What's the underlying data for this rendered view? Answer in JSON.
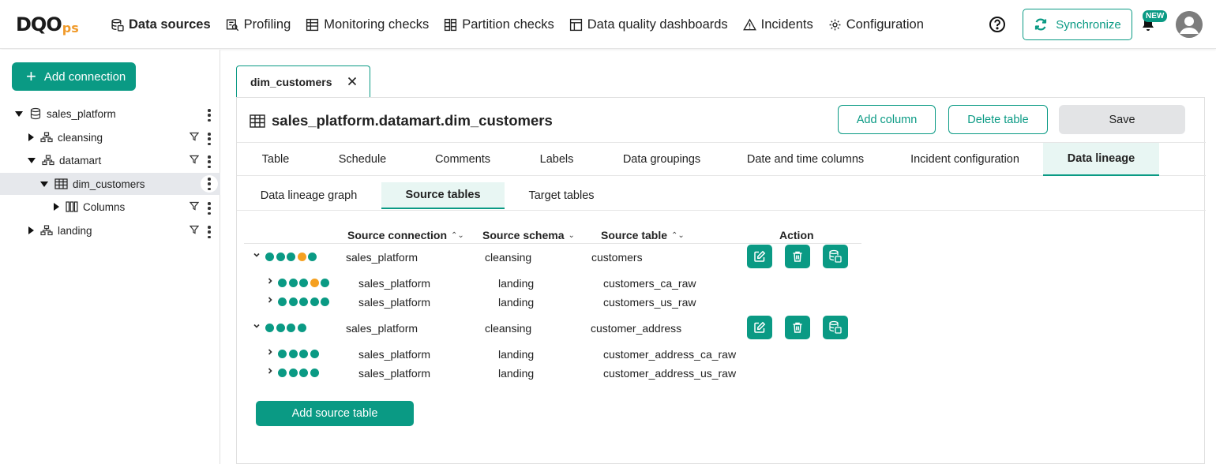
{
  "logo": {
    "main": "DQO",
    "sub": "ps"
  },
  "nav": {
    "items": [
      {
        "label": "Data sources",
        "icon": "database-icon",
        "active": true
      },
      {
        "label": "Profiling",
        "icon": "profiling-icon"
      },
      {
        "label": "Monitoring checks",
        "icon": "monitoring-icon"
      },
      {
        "label": "Partition checks",
        "icon": "partition-icon"
      },
      {
        "label": "Data quality dashboards",
        "icon": "dashboard-icon"
      },
      {
        "label": "Incidents",
        "icon": "warning-icon"
      },
      {
        "label": "Configuration",
        "icon": "gear-icon"
      }
    ],
    "synchronize_label": "Synchronize",
    "new_badge": "NEW"
  },
  "sidebar": {
    "add_connection_label": "Add connection",
    "tree": [
      {
        "label": "sales_platform",
        "level": 0,
        "expanded": true,
        "icon": "database-icon"
      },
      {
        "label": "cleansing",
        "level": 1,
        "expanded": false,
        "icon": "schema-icon"
      },
      {
        "label": "datamart",
        "level": 1,
        "expanded": true,
        "icon": "schema-icon"
      },
      {
        "label": "dim_customers",
        "level": 2,
        "expanded": true,
        "icon": "table-icon",
        "selected": true
      },
      {
        "label": "Columns",
        "level": 3,
        "expanded": false,
        "icon": "columns-icon"
      },
      {
        "label": "landing",
        "level": 1,
        "expanded": false,
        "icon": "schema-icon"
      }
    ]
  },
  "file_tab": {
    "label": "dim_customers"
  },
  "header": {
    "table_title": "sales_platform.datamart.dim_customers",
    "add_column_label": "Add column",
    "delete_table_label": "Delete table",
    "save_label": "Save"
  },
  "tabs": [
    "Table",
    "Schedule",
    "Comments",
    "Labels",
    "Data groupings",
    "Date and time columns",
    "Incident configuration",
    "Data lineage"
  ],
  "subtabs": [
    "Data lineage graph",
    "Source tables",
    "Target tables"
  ],
  "table": {
    "headers": {
      "source_connection": "Source connection",
      "source_schema": "Source schema",
      "source_table": "Source table",
      "action": "Action"
    },
    "rows": [
      {
        "expanded": true,
        "child": false,
        "dots": [
          "ok",
          "ok",
          "ok",
          "warn",
          "ok"
        ],
        "connection": "sales_platform",
        "schema": "cleansing",
        "table": "customers",
        "actions": true
      },
      {
        "expanded": false,
        "child": true,
        "dots": [
          "ok",
          "ok",
          "ok",
          "warn",
          "ok"
        ],
        "connection": "sales_platform",
        "schema": "landing",
        "table": "customers_ca_raw"
      },
      {
        "expanded": false,
        "child": true,
        "dots": [
          "ok",
          "ok",
          "ok",
          "ok",
          "ok"
        ],
        "connection": "sales_platform",
        "schema": "landing",
        "table": "customers_us_raw"
      },
      {
        "expanded": true,
        "child": false,
        "dots": [
          "ok",
          "ok",
          "ok",
          "ok"
        ],
        "connection": "sales_platform",
        "schema": "cleansing",
        "table": "customer_address",
        "actions": true
      },
      {
        "expanded": false,
        "child": true,
        "dots": [
          "ok",
          "ok",
          "ok",
          "ok"
        ],
        "connection": "sales_platform",
        "schema": "landing",
        "table": "customer_address_ca_raw"
      },
      {
        "expanded": false,
        "child": true,
        "dots": [
          "ok",
          "ok",
          "ok",
          "ok"
        ],
        "connection": "sales_platform",
        "schema": "landing",
        "table": "customer_address_us_raw"
      }
    ],
    "add_source_label": "Add source table"
  },
  "colors": {
    "accent": "#0a9a84",
    "warning": "#f5a020",
    "selected_bg": "#e6e8ec"
  }
}
